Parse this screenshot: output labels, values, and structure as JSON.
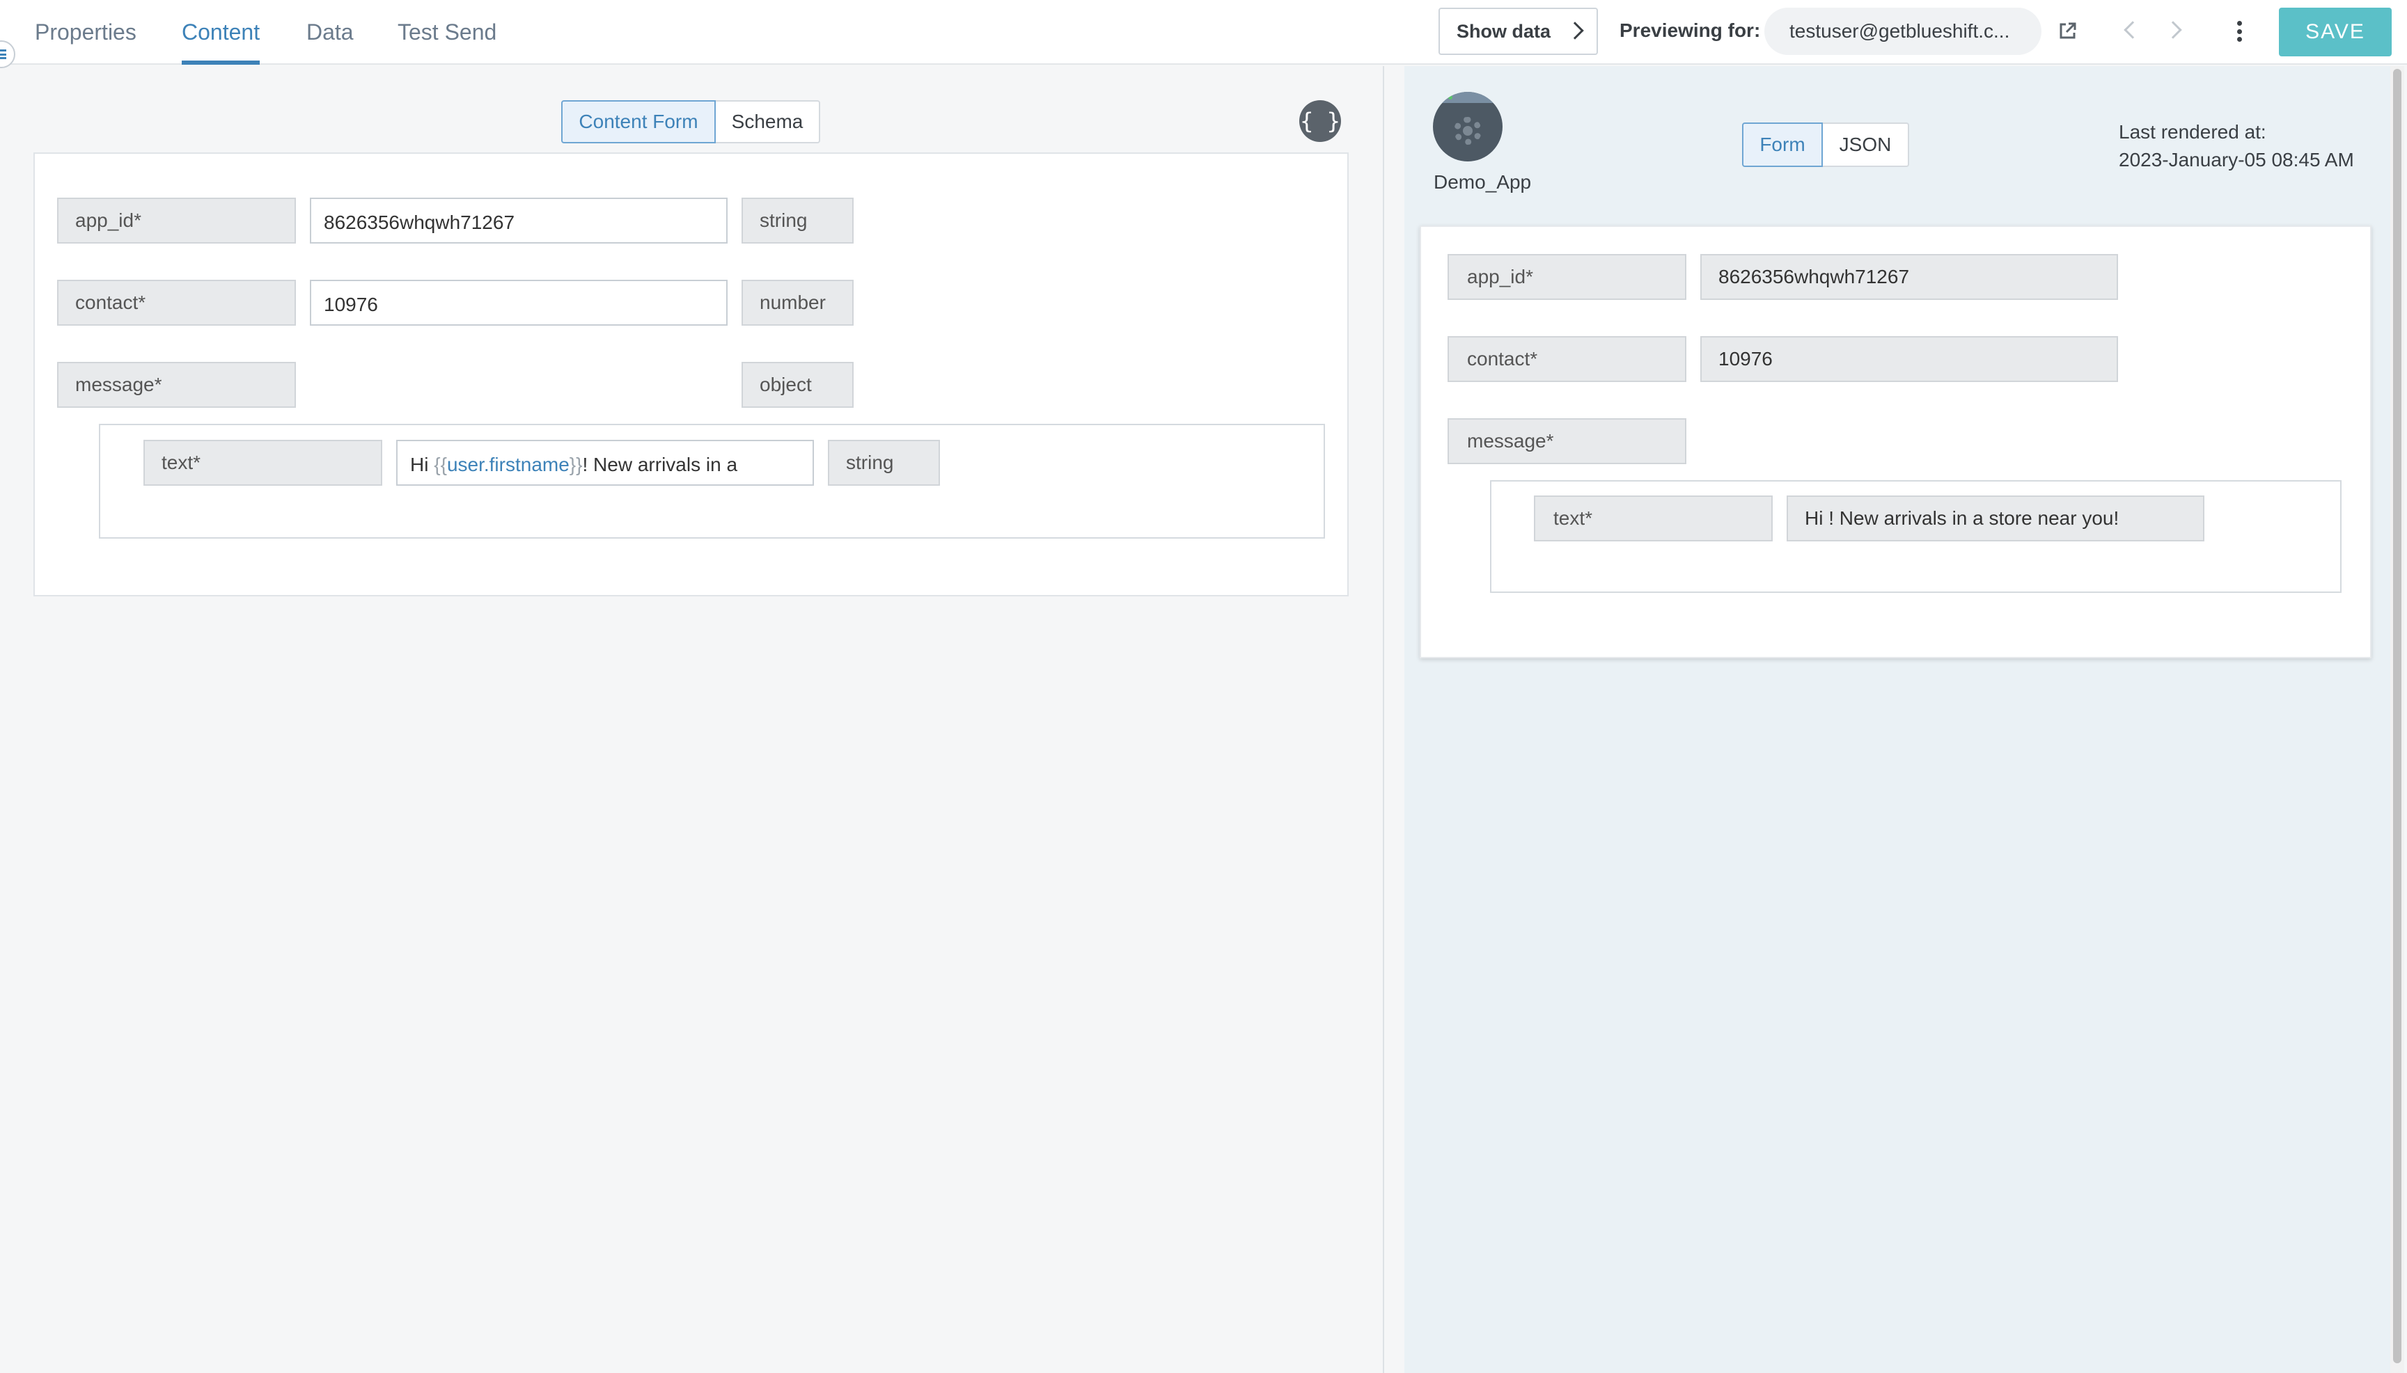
{
  "tabs": [
    {
      "label": "Properties"
    },
    {
      "label": "Content",
      "active": true
    },
    {
      "label": "Data"
    },
    {
      "label": "Test Send"
    }
  ],
  "header": {
    "show_data_label": "Show data",
    "previewing_label": "Previewing for:",
    "preview_user": "testuser@getblueshift.c...",
    "save_label": "SAVE"
  },
  "editor": {
    "mode_tabs": [
      {
        "label": "Content Form",
        "active": true
      },
      {
        "label": "Schema"
      }
    ],
    "braces_label": "{ }",
    "fields": [
      {
        "key": "app_id*",
        "value": "8626356whqwh71267",
        "type": "string"
      },
      {
        "key": "contact*",
        "value": "10976",
        "type": "number"
      },
      {
        "key": "message*",
        "value": "",
        "type": "object"
      }
    ],
    "nested_field": {
      "key": "text*",
      "value_prefix": "Hi ",
      "value_open": "{{",
      "value_var": "user.firstname",
      "value_close": "}}",
      "value_suffix": "! New arrivals in a",
      "type": "string"
    }
  },
  "preview": {
    "app_name": "Demo_App",
    "mode_tabs": [
      {
        "label": "Form",
        "active": true
      },
      {
        "label": "JSON"
      }
    ],
    "rendered_label": "Last rendered at:",
    "rendered_at": "2023-January-05 08:45 AM",
    "fields": [
      {
        "key": "app_id*",
        "value": "8626356whqwh71267"
      },
      {
        "key": "contact*",
        "value": "10976"
      },
      {
        "key": "message*",
        "value": ""
      }
    ],
    "nested_field": {
      "key": "text*",
      "value": "Hi ! New arrivals in a store near you!"
    }
  },
  "colors": {
    "accent": "#3d82b8",
    "save": "#5bc0c8"
  }
}
